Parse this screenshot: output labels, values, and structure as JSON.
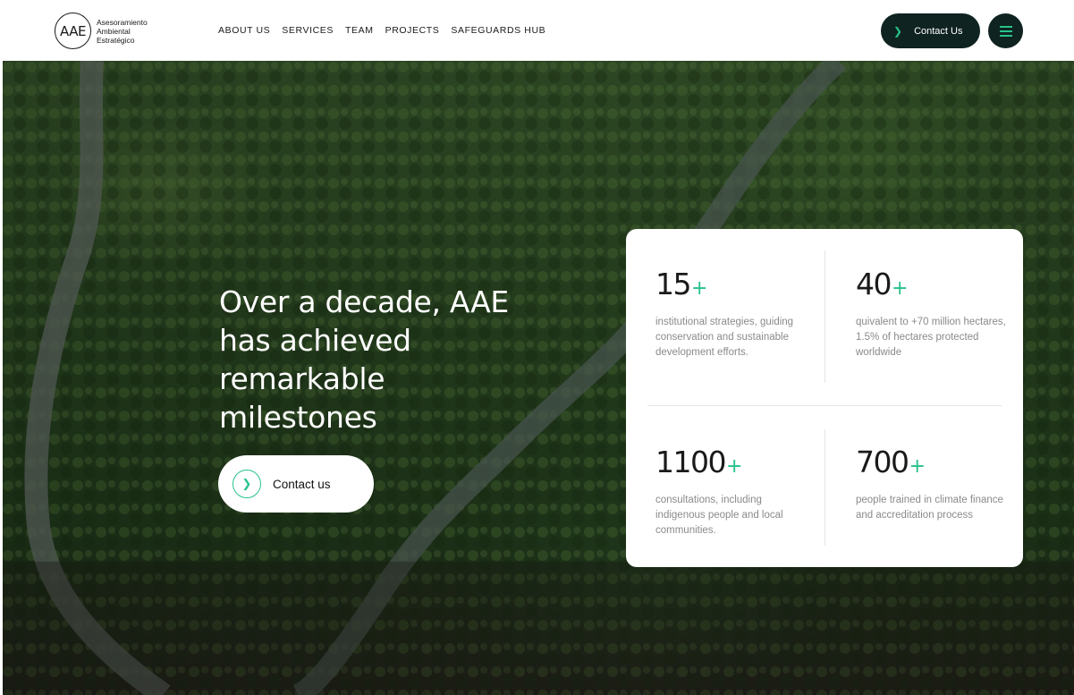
{
  "logo": {
    "mark": "AAE",
    "line1": "Asesoramiento",
    "line2": "Ambiental",
    "line3": "Estratégico"
  },
  "nav": {
    "items": [
      {
        "label": "ABOUT US"
      },
      {
        "label": "SERVICES"
      },
      {
        "label": "TEAM"
      },
      {
        "label": "PROJECTS"
      },
      {
        "label": "SAFEGUARDS HUB"
      }
    ]
  },
  "header": {
    "contact_label": "Contact Us",
    "contact_icon": "chevron-right-icon",
    "menu_icon": "hamburger-menu-icon"
  },
  "hero": {
    "headline": "Over a decade, AAE has achieved remarkable milestones",
    "cta_label": "Contact us",
    "cta_icon": "chevron-right-icon"
  },
  "stats": [
    {
      "value": "15",
      "suffix": "+",
      "description": "institutional strategies, guiding conservation and sustainable development efforts."
    },
    {
      "value": "40",
      "suffix": "+",
      "description": "quivalent to +70 million hectares, 1.5% of hectares protected worldwide"
    },
    {
      "value": "1100",
      "suffix": "+",
      "description": "consultations, including indigenous people and local communities."
    },
    {
      "value": "700",
      "suffix": "+",
      "description": "people trained in climate finance and accreditation process"
    }
  ],
  "colors": {
    "accent": "#27c28a",
    "dark_button": "#0f2320",
    "text_muted": "#8a8a8a"
  }
}
